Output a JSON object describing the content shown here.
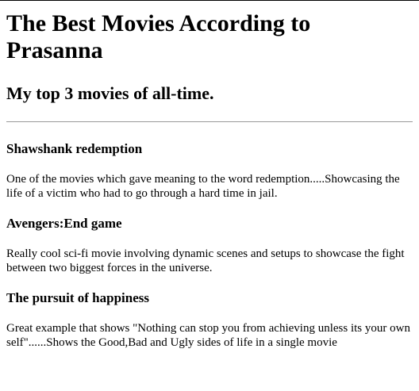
{
  "page": {
    "title": "The Best Movies According to Prasanna",
    "subtitle": "My top 3 movies of all-time."
  },
  "movies": [
    {
      "title": "Shawshank redemption",
      "description": "One of the movies which gave meaning to the word redemption.....Showcasing the life of a victim who had to go through a hard time in jail."
    },
    {
      "title": "Avengers:End game",
      "description": "Really cool sci-fi movie involving dynamic scenes and setups to showcase the fight between two biggest forces in the universe."
    },
    {
      "title": "The pursuit of happiness",
      "description": "Great example that shows \"Nothing can stop you from achieving unless its your own self\"......Shows the Good,Bad and Ugly sides of life in a single movie"
    }
  ]
}
